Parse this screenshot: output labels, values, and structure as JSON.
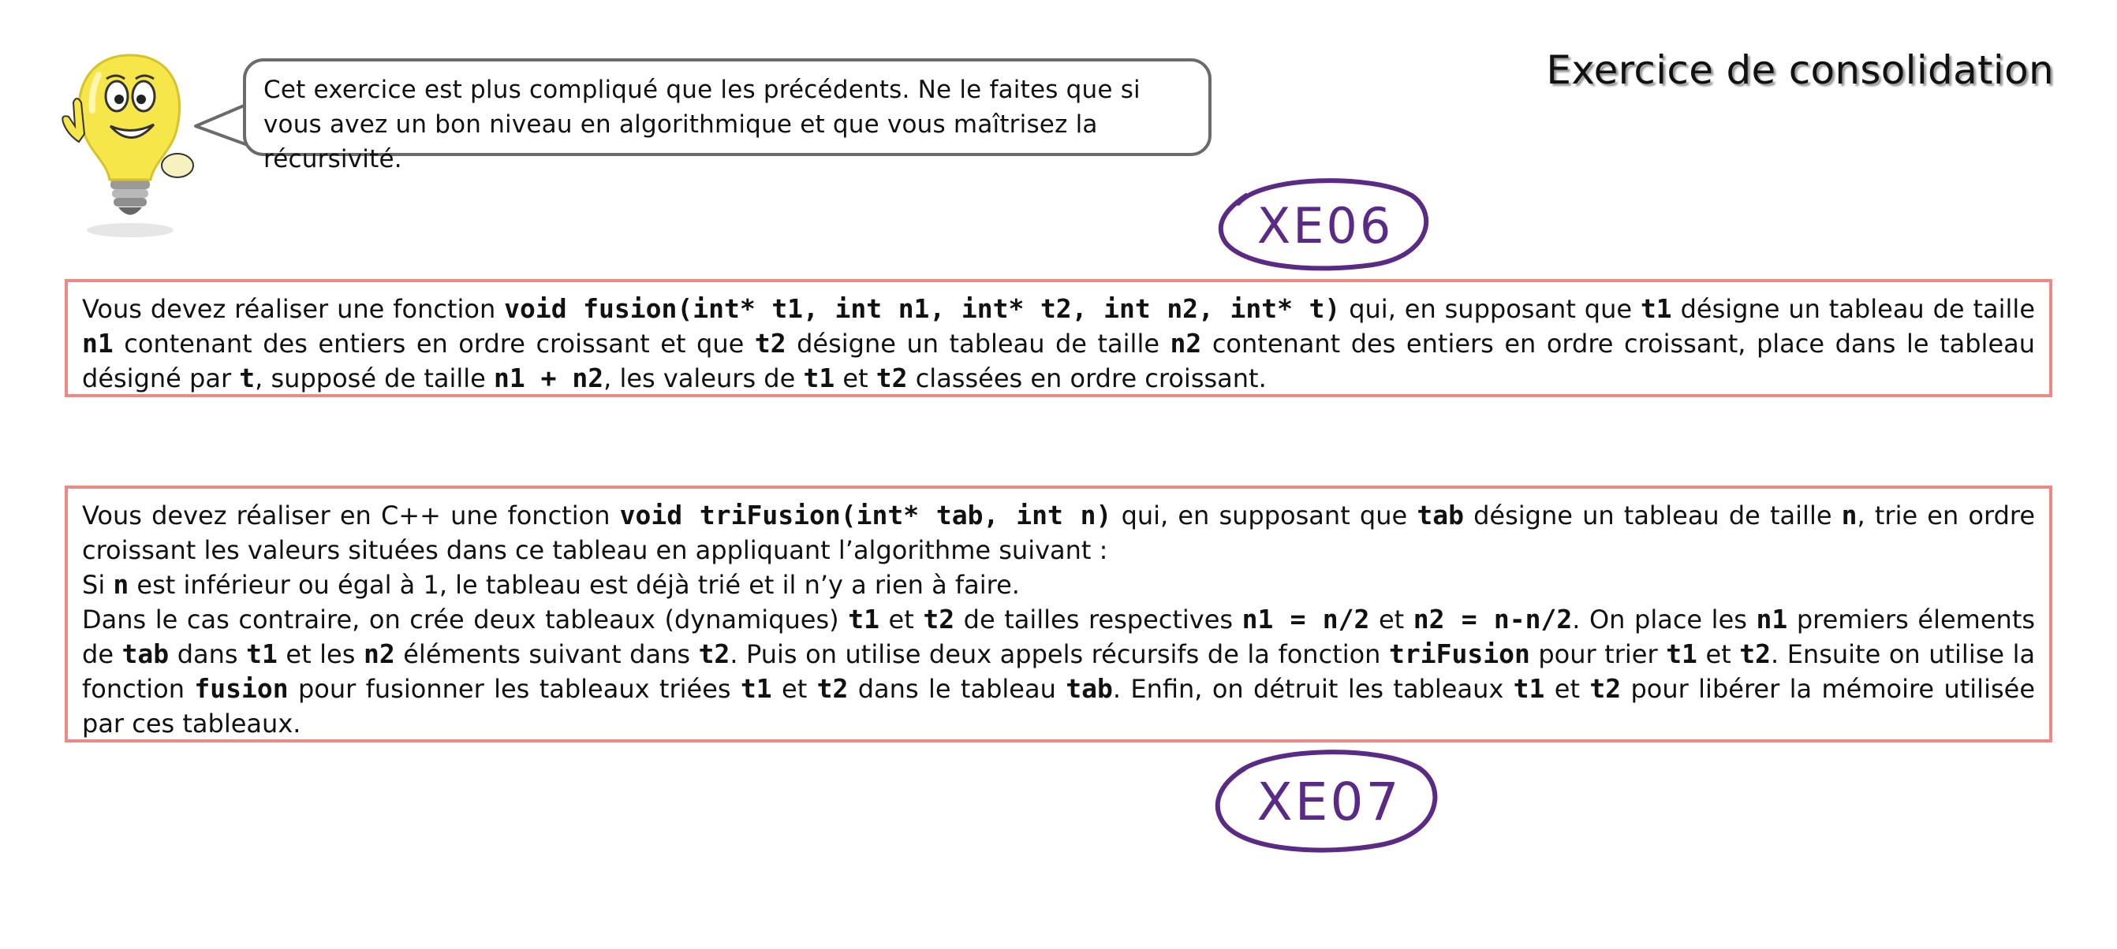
{
  "header": {
    "title": "Exercice de consolidation"
  },
  "hint": {
    "bubble_text": "Cet exercice est plus compliqué que les précédents. Ne le faites que si vous avez un bon niveau en algorithmique et que vous maîtrisez la récursivité."
  },
  "stamps": {
    "first": "XE06",
    "second": "XE07"
  },
  "exercise1": {
    "p1_a": "Vous devez réaliser une fonction ",
    "p1_sig": "void fusion(int* t1, int n1, int* t2, int n2, int* t)",
    "p1_b": " qui, en supposant que ",
    "p1_t1": "t1",
    "p1_c": " désigne un tableau de taille ",
    "p1_n1": "n1",
    "p1_d": " contenant des entiers en ordre croissant et que ",
    "p1_t2": "t2",
    "p1_e": " désigne un tableau de taille ",
    "p1_n2": "n2",
    "p1_f": " contenant des entiers en ordre croissant, place dans le tableau désigné par ",
    "p1_t": "t",
    "p1_g": ", supposé de taille ",
    "p1_sum": "n1 + n2",
    "p1_h": ", les valeurs de ",
    "p1_t1b": "t1",
    "p1_i": " et ",
    "p1_t2b": "t2",
    "p1_j": " classées en ordre croissant."
  },
  "exercise2": {
    "p1_a": "Vous devez réaliser en C++ une fonction ",
    "p1_sig": "void triFusion(int* tab, int n)",
    "p1_b": " qui, en supposant que ",
    "p1_tab": "tab",
    "p1_c": " désigne un tableau de taille ",
    "p1_n": "n",
    "p1_d": ", trie en ordre croissant les valeurs situées dans ce tableau en appliquant l’algorithme suivant :",
    "p2_a": "Si ",
    "p2_n": "n",
    "p2_b": " est inférieur ou égal à 1, le tableau est déjà trié et il n’y a rien à faire.",
    "p3_a": "Dans le cas contraire, on crée deux tableaux (dynamiques) ",
    "p3_t1": "t1",
    "p3_b": " et ",
    "p3_t2": "t2",
    "p3_c": " de tailles respectives ",
    "p3_n1": "n1 = n/2",
    "p3_d": " et ",
    "p3_n2": "n2 = n-n/2",
    "p3_e": ". On place les ",
    "p3_n1b": "n1",
    "p3_f": " premiers élements de ",
    "p3_tab": "tab",
    "p3_g": " dans ",
    "p3_t1b": "t1",
    "p3_h": " et les ",
    "p3_n2b": "n2",
    "p3_i": " éléments suivant dans ",
    "p3_t2b": "t2",
    "p3_j": ". Puis on utilise deux appels récursifs de la fonction ",
    "p3_tri": "triFusion",
    "p3_k": " pour trier ",
    "p3_t1c": "t1",
    "p3_l": " et ",
    "p3_t2c": "t2",
    "p3_m": ". Ensuite on utilise la fonction ",
    "p3_fus": "fusion",
    "p3_n": " pour fusionner les tableaux triées ",
    "p3_t1d": "t1",
    "p3_o": " et ",
    "p3_t2d": "t2",
    "p3_p": " dans le tableau ",
    "p3_tab2": "tab",
    "p3_q": ". Enfin, on détruit les tableaux ",
    "p3_t1e": "t1",
    "p3_r": " et ",
    "p3_t2e": "t2",
    "p3_s": " pour libérer la mémoire utilisée par ces tableaux."
  },
  "colors": {
    "box_border": "#ee8a86",
    "stamp_ink": "#5b2a86",
    "bubble_border": "#6b6b6b",
    "bulb": "#f7e64a"
  },
  "icons": {
    "mascot": "lightbulb-mascot-icon"
  }
}
